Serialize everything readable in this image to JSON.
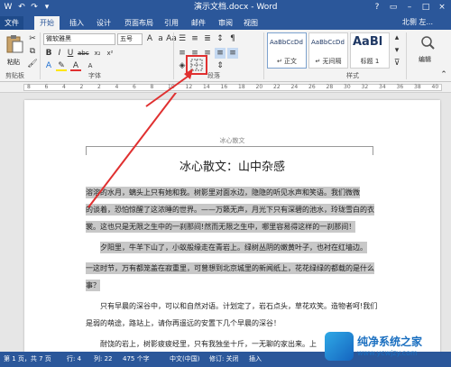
{
  "titlebar": {
    "title": "演示文档.docx - Word",
    "quick_access": [
      "W",
      "↶",
      "↷",
      "▾"
    ],
    "window_buttons": [
      "?",
      "▭",
      "–",
      "□",
      "×"
    ]
  },
  "tabs": {
    "items": [
      "文件",
      "开始",
      "插入",
      "设计",
      "页面布局",
      "引用",
      "邮件",
      "审阅",
      "视图"
    ],
    "user": "北侧 左...",
    "active": "开始"
  },
  "ribbon": {
    "clipboard": {
      "paste_label": "粘贴",
      "group_label": "剪贴板"
    },
    "font": {
      "font_name": "微软雅黑",
      "font_size": "五号",
      "group_label": "字体",
      "buttons": [
        "B",
        "I",
        "U",
        "abc",
        "x₂",
        "x²",
        "A",
        "A",
        "Aa",
        "A"
      ]
    },
    "paragraph": {
      "group_label": "段落"
    },
    "styles": {
      "group_label": "样式",
      "items": [
        {
          "preview": "AaBbCcDd",
          "name": "↵ 正文"
        },
        {
          "preview": "AaBbCcDd",
          "name": "↵ 无间隔"
        },
        {
          "preview": "AaBl",
          "name": "标题 1"
        }
      ]
    },
    "editing": {
      "label": "编辑"
    }
  },
  "ruler": {
    "numbers": [
      "8",
      "6",
      "4",
      "2",
      "2",
      "4",
      "6",
      "8",
      "10",
      "12",
      "14",
      "16",
      "18",
      "20",
      "22",
      "24",
      "26",
      "28",
      "30",
      "32",
      "34",
      "36",
      "38",
      "40"
    ]
  },
  "document": {
    "header": "冰心散文",
    "title": "冰心散文：山中杂感",
    "lines": [
      "溶溶的水月，螭头上只有她和我。树影里对面水边，隐隐的听见水声和笑语。我们微微",
      "的谈着，恐怕惊醒了这浓睡的世界。——万籁无声，月光下只有深碧的池水，玲珑雪白的衣",
      "裳。这也只是无限之生中的一刹那间!然而无限之生中，哪里容易得这样的一刹那间！",
      "夕阳里，牛羊下山了，小蚁般缘走在青岩上。绿树丛阴的嫩黄叶子，也衬在红墙边。",
      "一这时节，万有都笼盖在寂重里，可曾想到北京城里的新闻纸上，花花绿绿的都载的是什么",
      "事？",
      "只有早晨的深谷中，可以和自然对语。计划定了，岩石点头，草花欢笑。造物者呵!我们",
      "是弱的萌途，路站上，请你再遥远的安置下几个早晨的深谷！",
      "耐饶的岩上，树影疲疲经里，只有我独坐十斤，一无聊的家出来。上"
    ]
  },
  "status": {
    "page": "第 1 页，共 7 页",
    "words": "行: 4",
    "lines": "列: 22",
    "chars": "475 个字",
    "lang": "中文(中国)",
    "review": "修订: 关闭",
    "mode": "插入"
  },
  "watermark": {
    "line1": "纯净系统之家",
    "line2": "www.ycwjzy.com"
  },
  "colors": {
    "accent": "#2b579a",
    "highlight": "#c8c8c8",
    "annotation": "#e03030"
  }
}
